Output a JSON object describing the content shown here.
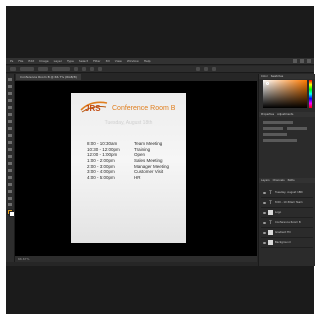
{
  "app": {
    "menus": [
      "Ps",
      "File",
      "Edit",
      "Image",
      "Layer",
      "Type",
      "Select",
      "Filter",
      "3D",
      "View",
      "Window",
      "Help"
    ],
    "document_tab": "Conference Room B @ 66.7% (RGB/8)",
    "status_text": "66.67%"
  },
  "document": {
    "title": "Conference Room B",
    "date": "Tuesday, August 18th",
    "schedule": [
      {
        "time": "8:00 - 10:30am",
        "event": "Team Meeting"
      },
      {
        "time": "10:30 - 12:00pm",
        "event": "Training"
      },
      {
        "time": "12:00 - 1:00pm",
        "event": "Open"
      },
      {
        "time": "1:00 - 2:00pm",
        "event": "Sales Meeting"
      },
      {
        "time": "2:00 - 3:00pm",
        "event": "Manager Meeting"
      },
      {
        "time": "3:00 - 4:00pm",
        "event": "Customer Visit"
      },
      {
        "time": "4:00 - 5:00pm",
        "event": "HR"
      }
    ]
  },
  "panels": {
    "color_tabs": [
      "Color",
      "Swatches"
    ],
    "properties_tabs": [
      "Properties",
      "Adjustments"
    ],
    "layers_tabs": [
      "Layers",
      "Channels",
      "Paths"
    ],
    "layers": [
      {
        "name": "Tuesday, August 18th",
        "kind": "text"
      },
      {
        "name": "8:00 - 10:30am Team",
        "kind": "text"
      },
      {
        "name": "Logo",
        "kind": "image"
      },
      {
        "name": "Conference Room B",
        "kind": "text"
      },
      {
        "name": "Gradient Fill",
        "kind": "image"
      },
      {
        "name": "Background",
        "kind": "image"
      }
    ]
  },
  "colors": {
    "accent_orange": "#e07f1f",
    "foreground_swatch": "#e5a020"
  },
  "icons": [
    "move-tool-icon",
    "marquee-tool-icon",
    "lasso-tool-icon",
    "crop-tool-icon",
    "brush-tool-icon",
    "type-tool-icon",
    "eye-icon"
  ]
}
